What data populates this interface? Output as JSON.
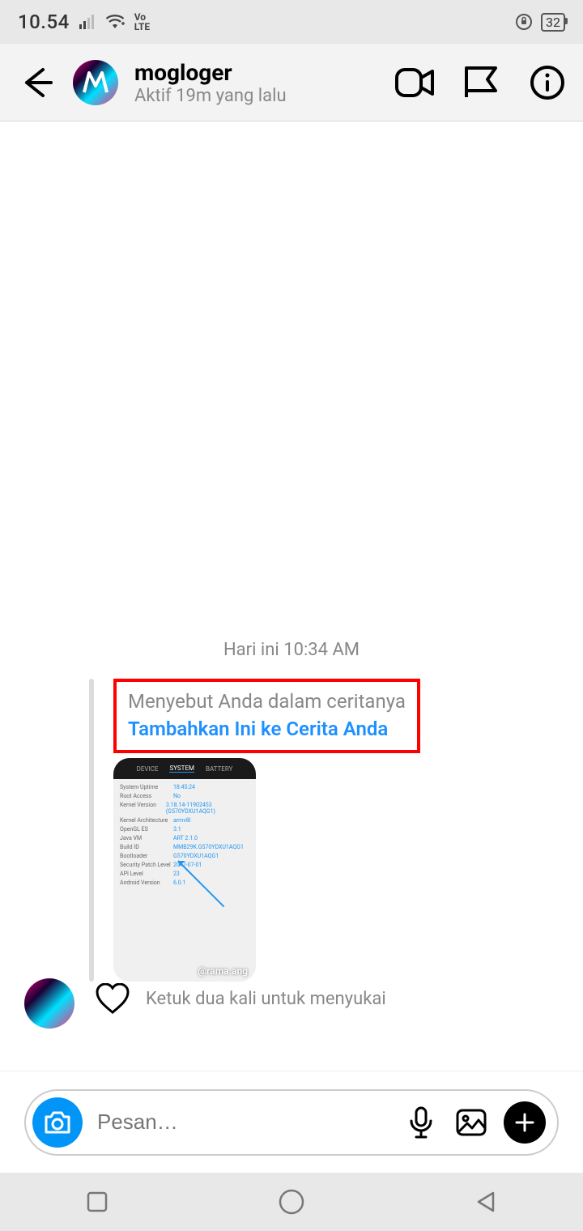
{
  "status": {
    "time": "10.54",
    "volte": "Vo LTE",
    "battery": "32"
  },
  "header": {
    "name": "mogloger",
    "subtitle": "Aktif 19m yang lalu"
  },
  "chat": {
    "timestamp": "Hari ini 10:34 AM",
    "mention_text": "Menyebut Anda dalam ceritanya",
    "add_story_text": "Tambahkan Ini ke Cerita Anda",
    "like_hint": "Ketuk dua kali untuk menyukai",
    "story_tag": "@rama.ang",
    "thumb_tabs": [
      "DEVICE",
      "SYSTEM",
      "BATTERY"
    ],
    "thumb_rows": [
      {
        "k": "Android Version",
        "v": "6.0.1"
      },
      {
        "k": "API Level",
        "v": "23"
      },
      {
        "k": "Security Patch Level",
        "v": "2017-07-01"
      },
      {
        "k": "Bootloader",
        "v": "G570YDXU1AQG1"
      },
      {
        "k": "Build ID",
        "v": "MMB29K.G570YDXU1AQG1"
      },
      {
        "k": "Java VM",
        "v": "ART 2.1.0"
      },
      {
        "k": "OpenGL ES",
        "v": "3.1"
      },
      {
        "k": "Kernel Architecture",
        "v": "armv8l"
      },
      {
        "k": "Kernel Version",
        "v": "3.18.14-11902453 (G570YDXU1AQG1)"
      },
      {
        "k": "Root Access",
        "v": "No"
      },
      {
        "k": "System Uptime",
        "v": "18:45:24"
      }
    ]
  },
  "composer": {
    "placeholder": "Pesan…"
  }
}
